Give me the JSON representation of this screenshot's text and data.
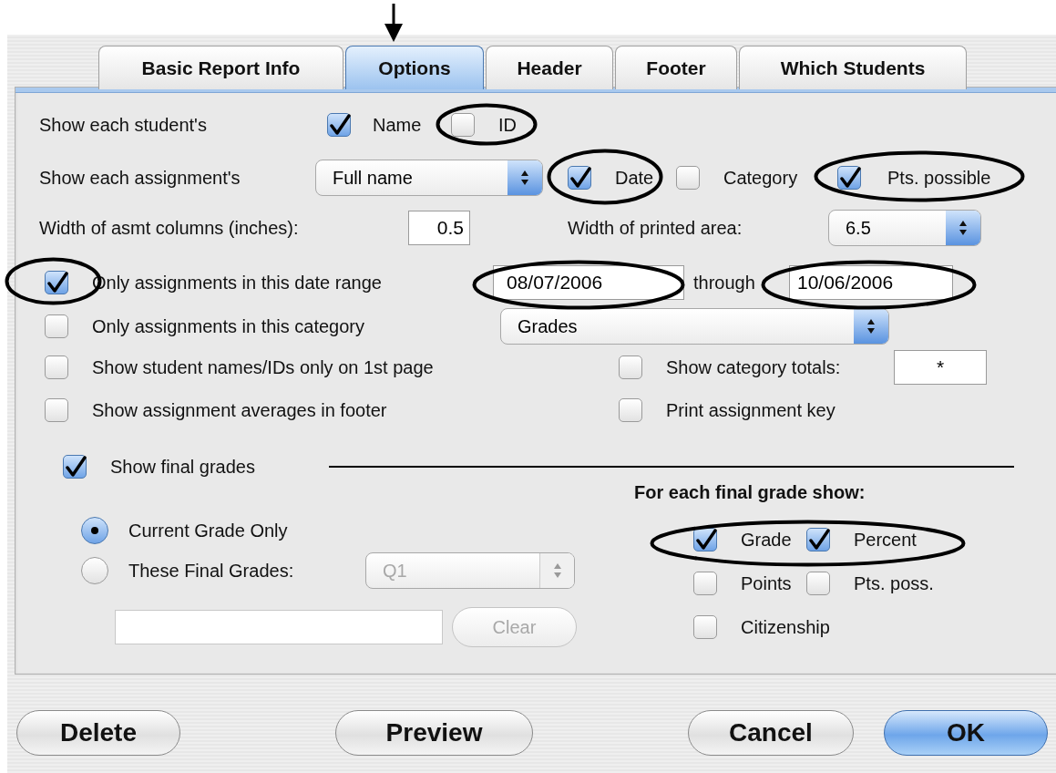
{
  "tabs": [
    {
      "label": "Basic Report Info",
      "selected": false
    },
    {
      "label": "Options",
      "selected": true
    },
    {
      "label": "Header",
      "selected": false
    },
    {
      "label": "Footer",
      "selected": false
    },
    {
      "label": "Which Students",
      "selected": false
    }
  ],
  "student_fields": {
    "label": "Show each student's",
    "options": [
      {
        "label": "Name",
        "checked": true
      },
      {
        "label": "ID",
        "checked": false
      }
    ]
  },
  "assignment_fields": {
    "label": "Show each assignment's",
    "name_format": "Full name",
    "options": [
      {
        "label": "Date",
        "checked": true
      },
      {
        "label": "Category",
        "checked": false
      },
      {
        "label": "Pts. possible",
        "checked": true
      }
    ]
  },
  "column_width": {
    "label": "Width of asmt columns (inches):",
    "value": "0.5"
  },
  "printed_width": {
    "label": "Width of printed area:",
    "value": "6.5"
  },
  "date_range": {
    "label": "Only assignments in this date range",
    "checked": true,
    "from": "08/07/2006",
    "through_label": "through",
    "to": "10/06/2006"
  },
  "category_filter": {
    "label": "Only assignments in this category",
    "checked": false,
    "value": "Grades"
  },
  "left_options": [
    {
      "label": "Show student names/IDs only on 1st page",
      "checked": false
    },
    {
      "label": "Show assignment averages in footer",
      "checked": false
    }
  ],
  "category_totals": {
    "label": "Show category totals:",
    "checked": false,
    "value": "*"
  },
  "assignment_key": {
    "label": "Print assignment key",
    "checked": false
  },
  "final_grades": {
    "label": "Show final grades",
    "checked": true,
    "modes": [
      {
        "label": "Current Grade Only",
        "selected": true
      },
      {
        "label": "These Final Grades:",
        "selected": false
      }
    ],
    "grade_set": {
      "value": "Q1",
      "disabled": true
    },
    "clear_button": {
      "label": "Clear",
      "disabled": true
    },
    "show_heading": "For each final grade show:",
    "show_options": [
      {
        "label": "Grade",
        "checked": true
      },
      {
        "label": "Percent",
        "checked": true
      },
      {
        "label": "Points",
        "checked": false
      },
      {
        "label": "Pts. poss.",
        "checked": false
      },
      {
        "label": "Citizenship",
        "checked": false
      }
    ]
  },
  "buttons": [
    {
      "label": "Delete",
      "default": false
    },
    {
      "label": "Preview",
      "default": false
    },
    {
      "label": "Cancel",
      "default": false
    },
    {
      "label": "OK",
      "default": true
    }
  ]
}
